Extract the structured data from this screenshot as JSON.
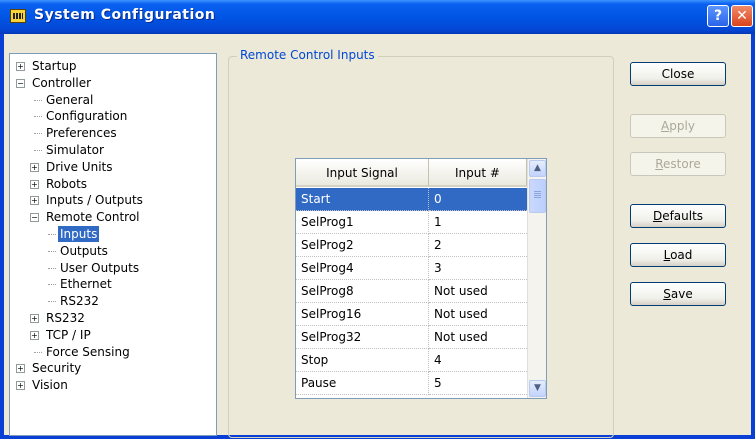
{
  "window": {
    "title": "System Configuration",
    "help_glyph": "?",
    "close_glyph": "✕"
  },
  "tree": {
    "items": [
      {
        "label": "Startup",
        "expander": "+"
      },
      {
        "label": "Controller",
        "expander": "−"
      },
      {
        "label": "General"
      },
      {
        "label": "Configuration"
      },
      {
        "label": "Preferences"
      },
      {
        "label": "Simulator"
      },
      {
        "label": "Drive Units",
        "expander": "+"
      },
      {
        "label": "Robots",
        "expander": "+"
      },
      {
        "label": "Inputs / Outputs",
        "expander": "+"
      },
      {
        "label": "Remote Control",
        "expander": "−"
      },
      {
        "label": "Inputs",
        "selected": true
      },
      {
        "label": "Outputs"
      },
      {
        "label": "User Outputs"
      },
      {
        "label": "Ethernet"
      },
      {
        "label": "RS232"
      },
      {
        "label": "RS232",
        "expander": "+"
      },
      {
        "label": "TCP / IP",
        "expander": "+"
      },
      {
        "label": "Force Sensing"
      },
      {
        "label": "Security",
        "expander": "+"
      },
      {
        "label": "Vision",
        "expander": "+"
      }
    ]
  },
  "group": {
    "legend": "Remote Control Inputs",
    "table": {
      "headers": [
        "Input Signal",
        "Input #"
      ],
      "rows": [
        [
          "Start",
          "0"
        ],
        [
          "SelProg1",
          "1"
        ],
        [
          "SelProg2",
          "2"
        ],
        [
          "SelProg4",
          "3"
        ],
        [
          "SelProg8",
          "Not used"
        ],
        [
          "SelProg16",
          "Not used"
        ],
        [
          "SelProg32",
          "Not used"
        ],
        [
          "Stop",
          "4"
        ],
        [
          "Pause",
          "5"
        ]
      ],
      "selected_row": 0
    }
  },
  "buttons": {
    "close": "Close",
    "apply": "Apply",
    "restore": "Restore",
    "defaults": "Defaults",
    "load": "Load",
    "save": "Save"
  },
  "colors": {
    "title_bar": "#0055e5",
    "selection": "#316ac5",
    "group_legend": "#0046d5",
    "dialog_face": "#ece9d8"
  },
  "icons": {
    "title": "keyboard-icon",
    "scroll_up": "▲",
    "scroll_down": "▼"
  }
}
